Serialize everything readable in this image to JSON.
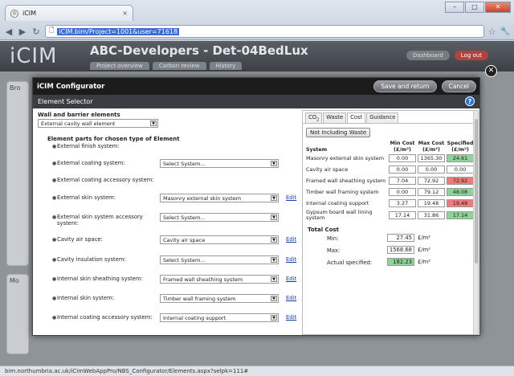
{
  "browser": {
    "tab_title": "iCIM",
    "tab_close": "×",
    "address": "iCIM.bim/Project=1001&user=71618",
    "status_url": "bim.northumbria.ac.uk/iCimWebAppPro/NBS_Configurator/Elements.aspx?selpk=111#"
  },
  "app": {
    "logo": "iCIM",
    "project_title": "ABC-Developers - Det-04BedLux",
    "tabs": [
      "Project overview",
      "Carbon review",
      "History"
    ],
    "dashboard": "Dashboard",
    "logout": "Log out",
    "side_1": "Bro",
    "side_2": "Mo"
  },
  "modal": {
    "title": "iCIM Configurator",
    "save_return": "Save and return",
    "cancel": "Cancel",
    "subheader": "Element Selector",
    "help": "?",
    "group_label": "Wall and barrier elements",
    "element_value": "External cavity wall element",
    "parts_title": "Element parts for chosen type of Element",
    "edit_label": "Edit",
    "parts": [
      {
        "label": "External finish system:",
        "value": null,
        "edit": false
      },
      {
        "label": "External coating system:",
        "value": "Select System...",
        "edit": false
      },
      {
        "label": "External coating accessory system:",
        "value": null,
        "edit": false
      },
      {
        "label": "External skin system:",
        "value": "Masonry external skin system",
        "edit": true
      },
      {
        "label": "External skin system accessory system:",
        "value": "Select System...",
        "edit": false
      },
      {
        "label": "Cavity air space:",
        "value": "Cavity air space",
        "edit": true
      },
      {
        "label": "Cavity insulation system:",
        "value": "Select System...",
        "edit": true
      },
      {
        "label": "Internal skin sheathing system:",
        "value": "Framed wall sheathing system",
        "edit": true
      },
      {
        "label": "Internal skin system:",
        "value": "Timber wall framing system",
        "edit": true
      },
      {
        "label": "Internal coating accessory system:",
        "value": "Internal coating support",
        "edit": true
      }
    ]
  },
  "cost_panel": {
    "tabs": [
      "CO2",
      "Waste",
      "Cost",
      "Guidance"
    ],
    "active_tab": "Cost",
    "not_including_waste": "Not Including Waste",
    "headers": {
      "system": "System",
      "min": "Min Cost",
      "max": "Max Cost",
      "specified": "Specified",
      "unit": "(£/m²)"
    },
    "rows": [
      {
        "name": "Masonry external skin system",
        "min": "0.00",
        "max": "1365.30",
        "spec": "24.61",
        "color": "green"
      },
      {
        "name": "Cavity air space",
        "min": "0.00",
        "max": "0.00",
        "spec": "0.00",
        "color": "none"
      },
      {
        "name": "Framed wall sheathing system",
        "min": "7.04",
        "max": "72.92",
        "spec": "72.92",
        "color": "red"
      },
      {
        "name": "Timber wall framing system",
        "min": "0.00",
        "max": "79.12",
        "spec": "48.08",
        "color": "green"
      },
      {
        "name": "Internal coating support",
        "min": "3.27",
        "max": "19.48",
        "spec": "19.48",
        "color": "red"
      },
      {
        "name": "Gypsum board wall lining system",
        "min": "17.14",
        "max": "31.86",
        "spec": "17.14",
        "color": "green"
      }
    ],
    "total": {
      "title": "Total Cost",
      "min_label": "Min:",
      "min": "27.45",
      "max_label": "Max:",
      "max": "1568.68",
      "actual_label": "Actual specified:",
      "actual": "182.23",
      "unit": "£/m²"
    },
    "colors": {
      "green": "#8fd39a",
      "red": "#f07a7a"
    }
  }
}
